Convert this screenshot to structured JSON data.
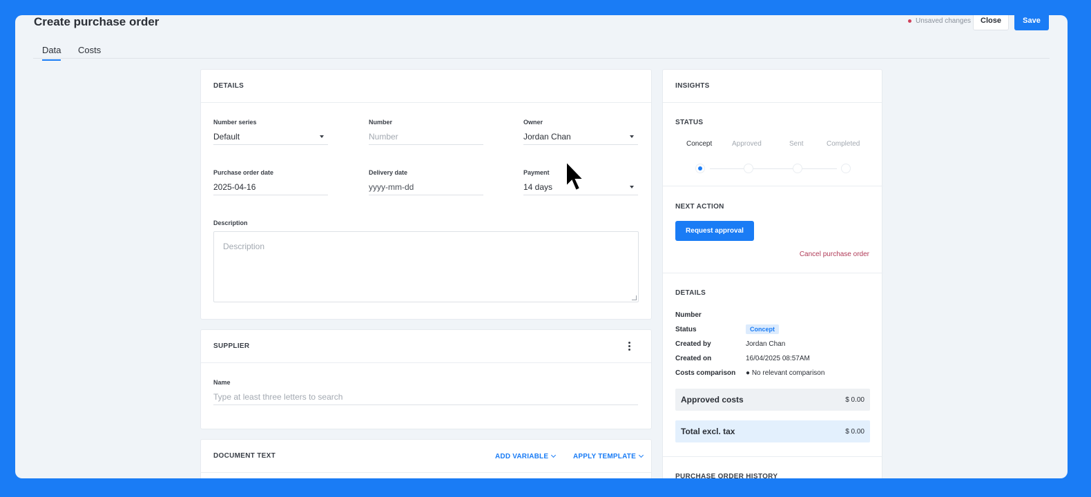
{
  "header": {
    "title": "Create purchase order",
    "unsaved_label": "Unsaved changes",
    "close_label": "Close",
    "save_label": "Save"
  },
  "tabs": [
    {
      "label": "Data",
      "active": true
    },
    {
      "label": "Costs",
      "active": false
    }
  ],
  "details": {
    "heading": "DETAILS",
    "number_series": {
      "label": "Number series",
      "value": "Default"
    },
    "number": {
      "label": "Number",
      "placeholder": "Number"
    },
    "owner": {
      "label": "Owner",
      "value": "Jordan Chan"
    },
    "purchase_order_date": {
      "label": "Purchase order date",
      "value": "2025-04-16"
    },
    "delivery_date": {
      "label": "Delivery date",
      "placeholder": "yyyy-mm-dd"
    },
    "payment_term": {
      "label": "Payment",
      "value": "14 days"
    },
    "description": {
      "label": "Description",
      "placeholder": "Description"
    }
  },
  "supplier": {
    "heading": "SUPPLIER",
    "name_label": "Name",
    "name_placeholder": "Type at least three letters to search"
  },
  "document_text": {
    "heading": "DOCUMENT TEXT",
    "add_variable": "ADD VARIABLE",
    "apply_template": "APPLY TEMPLATE"
  },
  "insights": {
    "heading": "INSIGHTS",
    "status_heading": "STATUS",
    "steps": [
      "Concept",
      "Approved",
      "Sent",
      "Completed"
    ],
    "current_step": 0,
    "next_action_heading": "NEXT ACTION",
    "request_approval": "Request approval",
    "cancel_order": "Cancel purchase order",
    "details_heading": "DETAILS",
    "rows": {
      "number_key": "Number",
      "status_key": "Status",
      "status_value": "Concept",
      "created_by_key": "Created by",
      "created_by_value": "Jordan Chan",
      "created_on_key": "Created on",
      "created_on_value": "16/04/2025 08:57AM",
      "costs_comparison_key": "Costs comparison",
      "costs_comparison_value": "No relevant comparison"
    },
    "approved_costs": {
      "label": "Approved costs",
      "value": "$ 0.00"
    },
    "total_excl_tax": {
      "label": "Total excl. tax",
      "value": "$ 0.00"
    },
    "history_heading": "PURCHASE ORDER HISTORY"
  },
  "colors": {
    "accent": "#1a7cf5",
    "danger": "#b03a57",
    "badge_bg": "#dcebfd",
    "total_bg": "#e3f0fd"
  },
  "icons": [
    "chevron-down-icon",
    "kebab-menu-icon",
    "mouse-cursor-icon",
    "resize-grip-icon"
  ]
}
